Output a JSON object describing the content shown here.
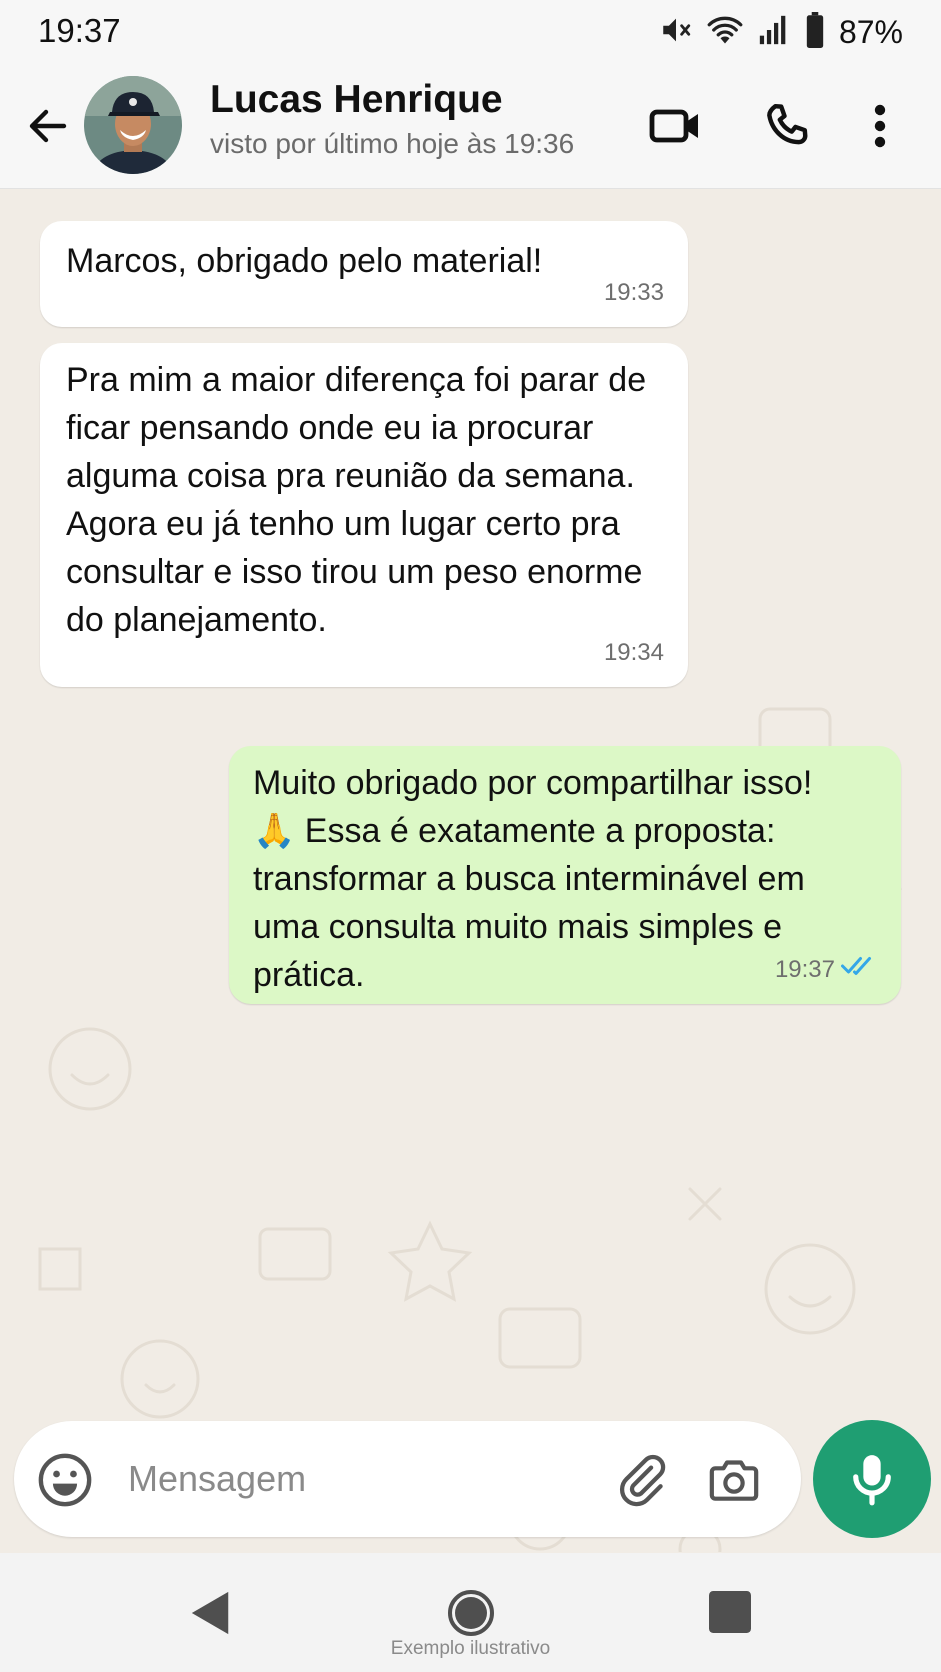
{
  "status_bar": {
    "time": "19:37",
    "battery": "87%",
    "icons": [
      "mute-icon",
      "wifi-icon",
      "signal-icon",
      "battery-icon"
    ]
  },
  "header": {
    "contact_name": "Lucas Henrique",
    "last_seen": "visto por último hoje às 19:36",
    "icons": [
      "back-arrow-icon",
      "video-call-icon",
      "phone-call-icon",
      "more-options-icon"
    ]
  },
  "messages": [
    {
      "direction": "incoming",
      "text": "Marcos, obrigado pelo material!",
      "time": "19:33"
    },
    {
      "direction": "incoming",
      "text": "Pra mim a maior diferença foi parar de ficar pensando onde eu ia procurar alguma coisa pra reunião da semana. Agora eu já tenho um lugar certo pra consultar e isso tirou um peso enorme do planejamento.",
      "time": "19:34"
    },
    {
      "direction": "outgoing",
      "text": "Muito obrigado por compartilhar isso! 🙏 Essa é exatamente a proposta: transformar a busca interminável em uma consulta muito mais simples e prática.",
      "time": "19:37",
      "status": "read"
    }
  ],
  "input": {
    "placeholder": "Mensagem",
    "value": "",
    "icons": [
      "emoji-icon",
      "attach-icon",
      "camera-icon",
      "mic-icon"
    ]
  },
  "nav_bar": {
    "icons": [
      "nav-back-icon",
      "nav-home-icon",
      "nav-recents-icon"
    ]
  },
  "watermark": "Exemplo ilustrativo",
  "colors": {
    "chat_background": "#f1ece5",
    "incoming_bubble": "#ffffff",
    "outgoing_bubble": "#dcf8c6",
    "accent_green": "#1f9e72",
    "read_ticks": "#34a7e8"
  }
}
